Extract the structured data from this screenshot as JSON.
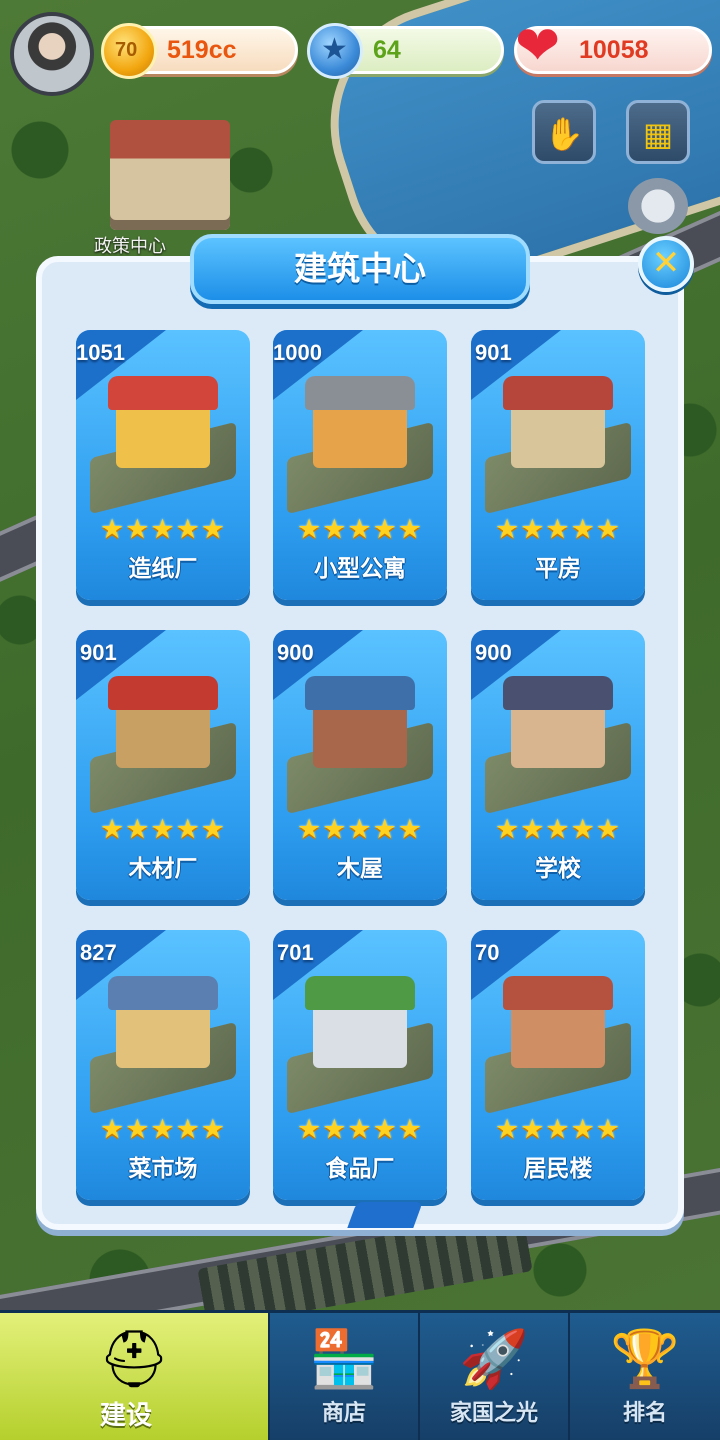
{
  "top_bar": {
    "coin": {
      "icon": "coin-icon",
      "glyph": "70",
      "value": "519cc"
    },
    "star": {
      "icon": "star-badge-icon",
      "glyph": "★",
      "value": "64"
    },
    "heart": {
      "icon": "heart-icon",
      "glyph": "❤",
      "value": "10058"
    }
  },
  "map": {
    "label": "政策中心"
  },
  "side_buttons": [
    {
      "icon": "ghostbuster-icon",
      "glyph": "✋"
    },
    {
      "icon": "building-icon",
      "glyph": "▦"
    }
  ],
  "panel": {
    "title": "建筑中心",
    "close_glyph": "✕",
    "cards": [
      {
        "count": "1051",
        "name": "造纸厂",
        "stars": "★★★★★",
        "colors": {
          "roof": "#d2453a",
          "body": "#f0c14a"
        }
      },
      {
        "count": "1000",
        "name": "小型公寓",
        "stars": "★★★★★",
        "colors": {
          "roof": "#8a8f96",
          "body": "#e7a34a"
        }
      },
      {
        "count": "901",
        "name": "平房",
        "stars": "★★★★★",
        "colors": {
          "roof": "#b6463b",
          "body": "#d9c59a"
        }
      },
      {
        "count": "901",
        "name": "木材厂",
        "stars": "★★★★★",
        "colors": {
          "roof": "#c23a30",
          "body": "#c9a063"
        }
      },
      {
        "count": "900",
        "name": "木屋",
        "stars": "★★★★★",
        "colors": {
          "roof": "#3f6fa8",
          "body": "#a8664a"
        }
      },
      {
        "count": "900",
        "name": "学校",
        "stars": "★★★★★",
        "colors": {
          "roof": "#4a5170",
          "body": "#d8b58e"
        }
      },
      {
        "count": "827",
        "name": "菜市场",
        "stars": "★★★★★",
        "colors": {
          "roof": "#5a7fb0",
          "body": "#e2c27a"
        }
      },
      {
        "count": "701",
        "name": "食品厂",
        "stars": "★★★★★",
        "colors": {
          "roof": "#4e9a45",
          "body": "#d9dfe4"
        }
      },
      {
        "count": "70",
        "name": "居民楼",
        "stars": "★★★★★",
        "colors": {
          "roof": "#b5523f",
          "body": "#cf8e63"
        }
      }
    ]
  },
  "bottom_nav": [
    {
      "label": "建设",
      "icon": "hardhat-icon",
      "glyph": "⛑",
      "active": true
    },
    {
      "label": "商店",
      "icon": "shop-icon",
      "glyph": "🏪",
      "active": false
    },
    {
      "label": "家国之光",
      "icon": "rocket-icon",
      "glyph": "🚀",
      "active": false
    },
    {
      "label": "排名",
      "icon": "ranking-icon",
      "glyph": "🏆",
      "active": false
    }
  ],
  "colors": {
    "accent": "#2e9df0",
    "panel": "#dce9f7",
    "nav": "#1f5c8f",
    "nav_active": "#c9e04a"
  }
}
